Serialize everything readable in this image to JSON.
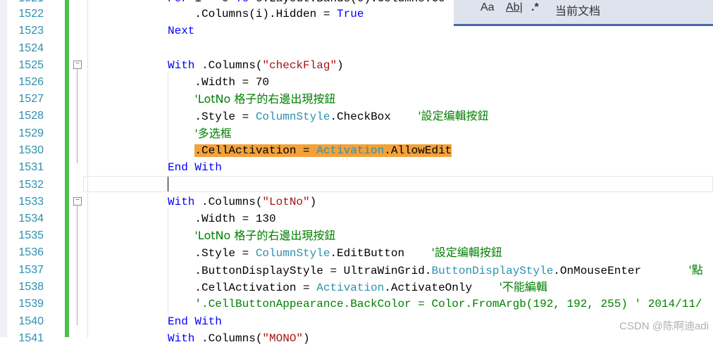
{
  "toolbar": {
    "match_case_label": "Aa",
    "whole_word_label": "Ab|",
    "regex_label": ".*",
    "scope_label": "当前文档"
  },
  "editor": {
    "top_partial": ".Columns(i).Hidden = True",
    "lines": [
      {
        "num": "1522",
        "text": "    .Columns(i).Hidden = True"
      },
      {
        "num": "1523",
        "text": "Next"
      },
      {
        "num": "1524",
        "text": ""
      },
      {
        "num": "1525",
        "text": "With .Columns(\"checkFlag\")"
      },
      {
        "num": "1526",
        "text": "    .Width = 70"
      },
      {
        "num": "1527",
        "text": "    'LotNo 格子的右邊出現按鈕"
      },
      {
        "num": "1528",
        "text": "    .Style = ColumnStyle.CheckBox    '設定编輯按鈕"
      },
      {
        "num": "1529",
        "text": "    '多选框"
      },
      {
        "num": "1530",
        "text": "    .CellActivation = Activation.AllowEdit"
      },
      {
        "num": "1531",
        "text": "End With"
      },
      {
        "num": "1532",
        "text": ""
      },
      {
        "num": "1533",
        "text": "With .Columns(\"LotNo\")"
      },
      {
        "num": "1534",
        "text": "    .Width = 130"
      },
      {
        "num": "1535",
        "text": "    'LotNo 格子的右邊出現按鈕"
      },
      {
        "num": "1536",
        "text": "    .Style = ColumnStyle.EditButton    '設定编輯按鈕"
      },
      {
        "num": "1537",
        "text": "    .ButtonDisplayStyle = UltraWinGrid.ButtonDisplayStyle.OnMouseEnter       '點"
      },
      {
        "num": "1538",
        "text": "    .CellActivation = Activation.ActivateOnly    '不能編輯"
      },
      {
        "num": "1539",
        "text": "    '.CellButtonAppearance.BackColor = Color.FromArgb(192, 192, 255) ' 2014/11/"
      },
      {
        "num": "1540",
        "text": "End With"
      }
    ]
  },
  "watermark": "CSDN @陈啊迪adi",
  "colors": {
    "keyword": "#0000ff",
    "string": "#a31515",
    "comment": "#008000",
    "type": "#2b91af",
    "highlight": "#f3a23a",
    "change_bar": "#4cc14c"
  }
}
